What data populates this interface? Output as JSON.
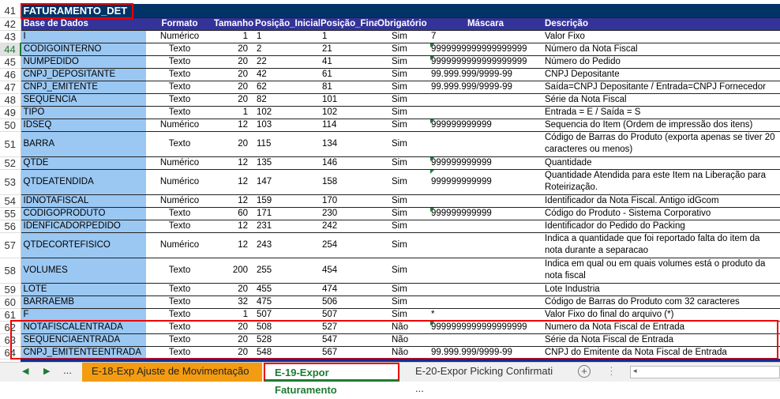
{
  "title": {
    "row": "41",
    "text": "FATURAMENTO_DET"
  },
  "headers": {
    "row": "42",
    "cols": [
      "Base de Dados",
      "Formato",
      "Tamanho",
      "Posição_Inicial",
      "Posição_Final",
      "Obrigatório",
      "Máscara",
      "Descrição"
    ]
  },
  "rows": [
    [
      "43",
      "I",
      "Numérico",
      "1",
      "1",
      "1",
      "Sim",
      "7",
      "Valor Fixo"
    ],
    [
      "44",
      "CODIGOINTERNO",
      "Texto",
      "20",
      "2",
      "21",
      "Sim",
      "9999999999999999999",
      "Número da Nota Fiscal"
    ],
    [
      "45",
      "NUMPEDIDO",
      "Texto",
      "20",
      "22",
      "41",
      "Sim",
      "9999999999999999999",
      "Número do Pedido"
    ],
    [
      "46",
      "CNPJ_DEPOSITANTE",
      "Texto",
      "20",
      "42",
      "61",
      "Sim",
      "99.999.999/9999-99",
      "CNPJ Depositante"
    ],
    [
      "47",
      "CNPJ_EMITENTE",
      "Texto",
      "20",
      "62",
      "81",
      "Sim",
      "99.999.999/9999-99",
      "Saída=CNPJ Depositante / Entrada=CNPJ Fornecedor"
    ],
    [
      "48",
      "SEQUENCIA",
      "Texto",
      "20",
      "82",
      "101",
      "Sim",
      "",
      "Série da Nota Fiscal"
    ],
    [
      "49",
      "TIPO",
      "Texto",
      "1",
      "102",
      "102",
      "Sim",
      "",
      "Entrada = E / Saída = S"
    ],
    [
      "50",
      "IDSEQ",
      "Numérico",
      "12",
      "103",
      "114",
      "Sim",
      "999999999999",
      "Sequencia do Item (Ordem de impressão dos itens)"
    ],
    [
      "51",
      "BARRA",
      "Texto",
      "20",
      "115",
      "134",
      "Sim",
      "",
      "Código de Barras do Produto (exporta apenas se tiver 20 caracteres ou menos)"
    ],
    [
      "52",
      "QTDE",
      "Numérico",
      "12",
      "135",
      "146",
      "Sim",
      "999999999999",
      "Quantidade"
    ],
    [
      "53",
      "QTDEATENDIDA",
      "Numérico",
      "12",
      "147",
      "158",
      "Sim",
      "999999999999",
      "Quantidade Atendida para este Item na Liberação para Roteirização."
    ],
    [
      "54",
      "IDNOTAFISCAL",
      "Numérico",
      "12",
      "159",
      "170",
      "Sim",
      "",
      "Identificador da Nota Fiscal. Antigo idGcom"
    ],
    [
      "55",
      "CODIGOPRODUTO",
      "Texto",
      "60",
      "171",
      "230",
      "Sim",
      "999999999999",
      "Código do Produto - Sistema Corporativo"
    ],
    [
      "56",
      "IDENFICADORPEDIDO",
      "Texto",
      "12",
      "231",
      "242",
      "Sim",
      "",
      "Identificador do Pedido do Packing"
    ],
    [
      "57",
      "QTDECORTEFISICO",
      "Numérico",
      "12",
      "243",
      "254",
      "Sim",
      "",
      "Indica a quantidade que foi reportado falta do item da nota durante a separacao"
    ],
    [
      "58",
      "VOLUMES",
      "Texto",
      "200",
      "255",
      "454",
      "Sim",
      "",
      "Indica em qual ou em quais volumes está o produto da nota fiscal"
    ],
    [
      "59",
      "LOTE",
      "Texto",
      "20",
      "455",
      "474",
      "Sim",
      "",
      "Lote Industria"
    ],
    [
      "60",
      "BARRAEMB",
      "Texto",
      "32",
      "475",
      "506",
      "Sim",
      "",
      "Código de Barras do Produto com 32 caracteres"
    ],
    [
      "61",
      "F",
      "Texto",
      "1",
      "507",
      "507",
      "Sim",
      "*",
      "Valor Fixo do final do arquivo (*)"
    ],
    [
      "62",
      "NOTAFISCALENTRADA",
      "Texto",
      "20",
      "508",
      "527",
      "Não",
      "9999999999999999999",
      "Numero da Nota Fiscal de Entrada"
    ],
    [
      "63",
      "SEQUENCIAENTRADA",
      "Texto",
      "20",
      "528",
      "547",
      "Não",
      "",
      "Série da Nota Fiscal de Entrada"
    ],
    [
      "64",
      "CNPJ_EMITENTEENTRADA",
      "Texto",
      "20",
      "548",
      "567",
      "Não",
      "99.999.999/9999-99",
      "CNPJ do Emitente da Nota Fiscal de Entrada"
    ]
  ],
  "tall_rows": [
    "51",
    "53",
    "57",
    "58"
  ],
  "triangle_rows": [
    "44",
    "45",
    "50",
    "52",
    "53",
    "55",
    "62"
  ],
  "tabs": {
    "more": "...",
    "items": [
      "E-18-Exp Ajuste de Movimentação",
      "E-19-Expor Faturamento",
      "E-20-Expor Picking Confirmati ..."
    ],
    "active": 1
  }
}
